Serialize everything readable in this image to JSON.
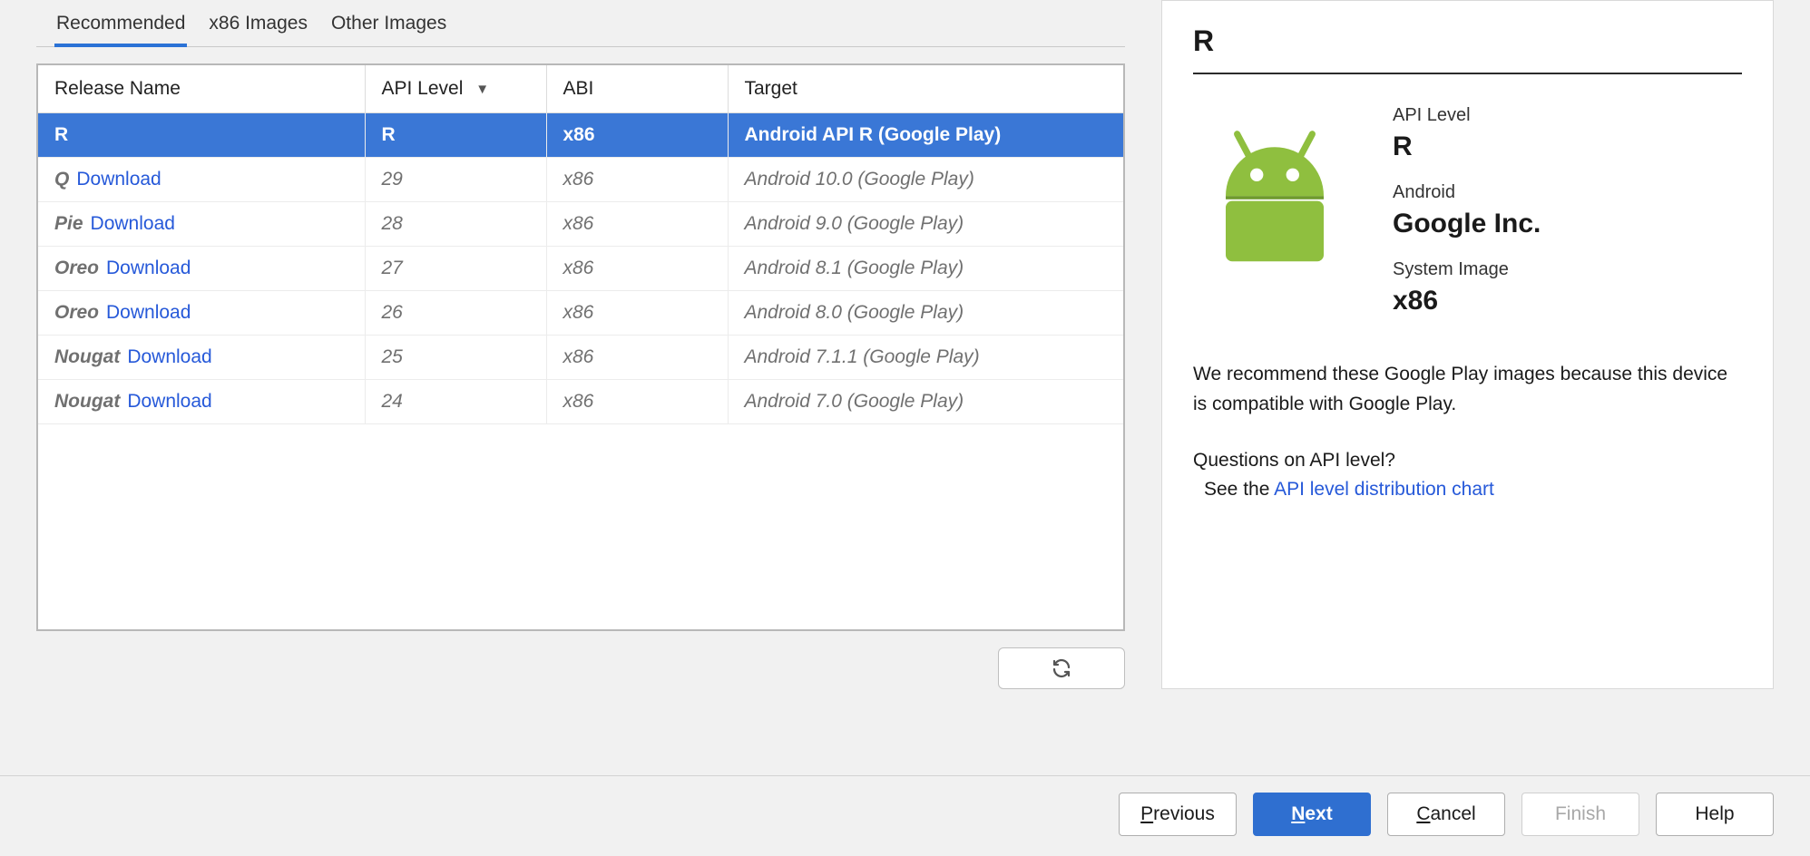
{
  "tabs": {
    "recommended": "Recommended",
    "x86": "x86 Images",
    "other": "Other Images",
    "active": "recommended"
  },
  "columns": {
    "release": "Release Name",
    "api": "API Level",
    "abi": "ABI",
    "target": "Target"
  },
  "download_label": "Download",
  "rows": [
    {
      "release": "R",
      "api": "R",
      "abi": "x86",
      "target": "Android API R (Google Play)",
      "selected": true,
      "downloadable": false
    },
    {
      "release": "Q",
      "api": "29",
      "abi": "x86",
      "target": "Android 10.0 (Google Play)",
      "selected": false,
      "downloadable": true
    },
    {
      "release": "Pie",
      "api": "28",
      "abi": "x86",
      "target": "Android 9.0 (Google Play)",
      "selected": false,
      "downloadable": true
    },
    {
      "release": "Oreo",
      "api": "27",
      "abi": "x86",
      "target": "Android 8.1 (Google Play)",
      "selected": false,
      "downloadable": true
    },
    {
      "release": "Oreo",
      "api": "26",
      "abi": "x86",
      "target": "Android 8.0 (Google Play)",
      "selected": false,
      "downloadable": true
    },
    {
      "release": "Nougat",
      "api": "25",
      "abi": "x86",
      "target": "Android 7.1.1 (Google Play)",
      "selected": false,
      "downloadable": true
    },
    {
      "release": "Nougat",
      "api": "24",
      "abi": "x86",
      "target": "Android 7.0 (Google Play)",
      "selected": false,
      "downloadable": true
    }
  ],
  "detail": {
    "title": "R",
    "api_label": "API Level",
    "api_value": "R",
    "android_label": "Android",
    "vendor": "Google Inc.",
    "sysimg_label": "System Image",
    "sysimg_value": "x86",
    "recommend_text": "We recommend these Google Play images because this device is compatible with Google Play.",
    "question": "Questions on API level?",
    "see_prefix": "See the ",
    "see_link": "API level distribution chart"
  },
  "buttons": {
    "previous": "Previous",
    "previous_mn": "P",
    "next": "Next",
    "next_mn": "N",
    "cancel": "Cancel",
    "cancel_mn": "C",
    "finish": "Finish",
    "help": "Help"
  }
}
